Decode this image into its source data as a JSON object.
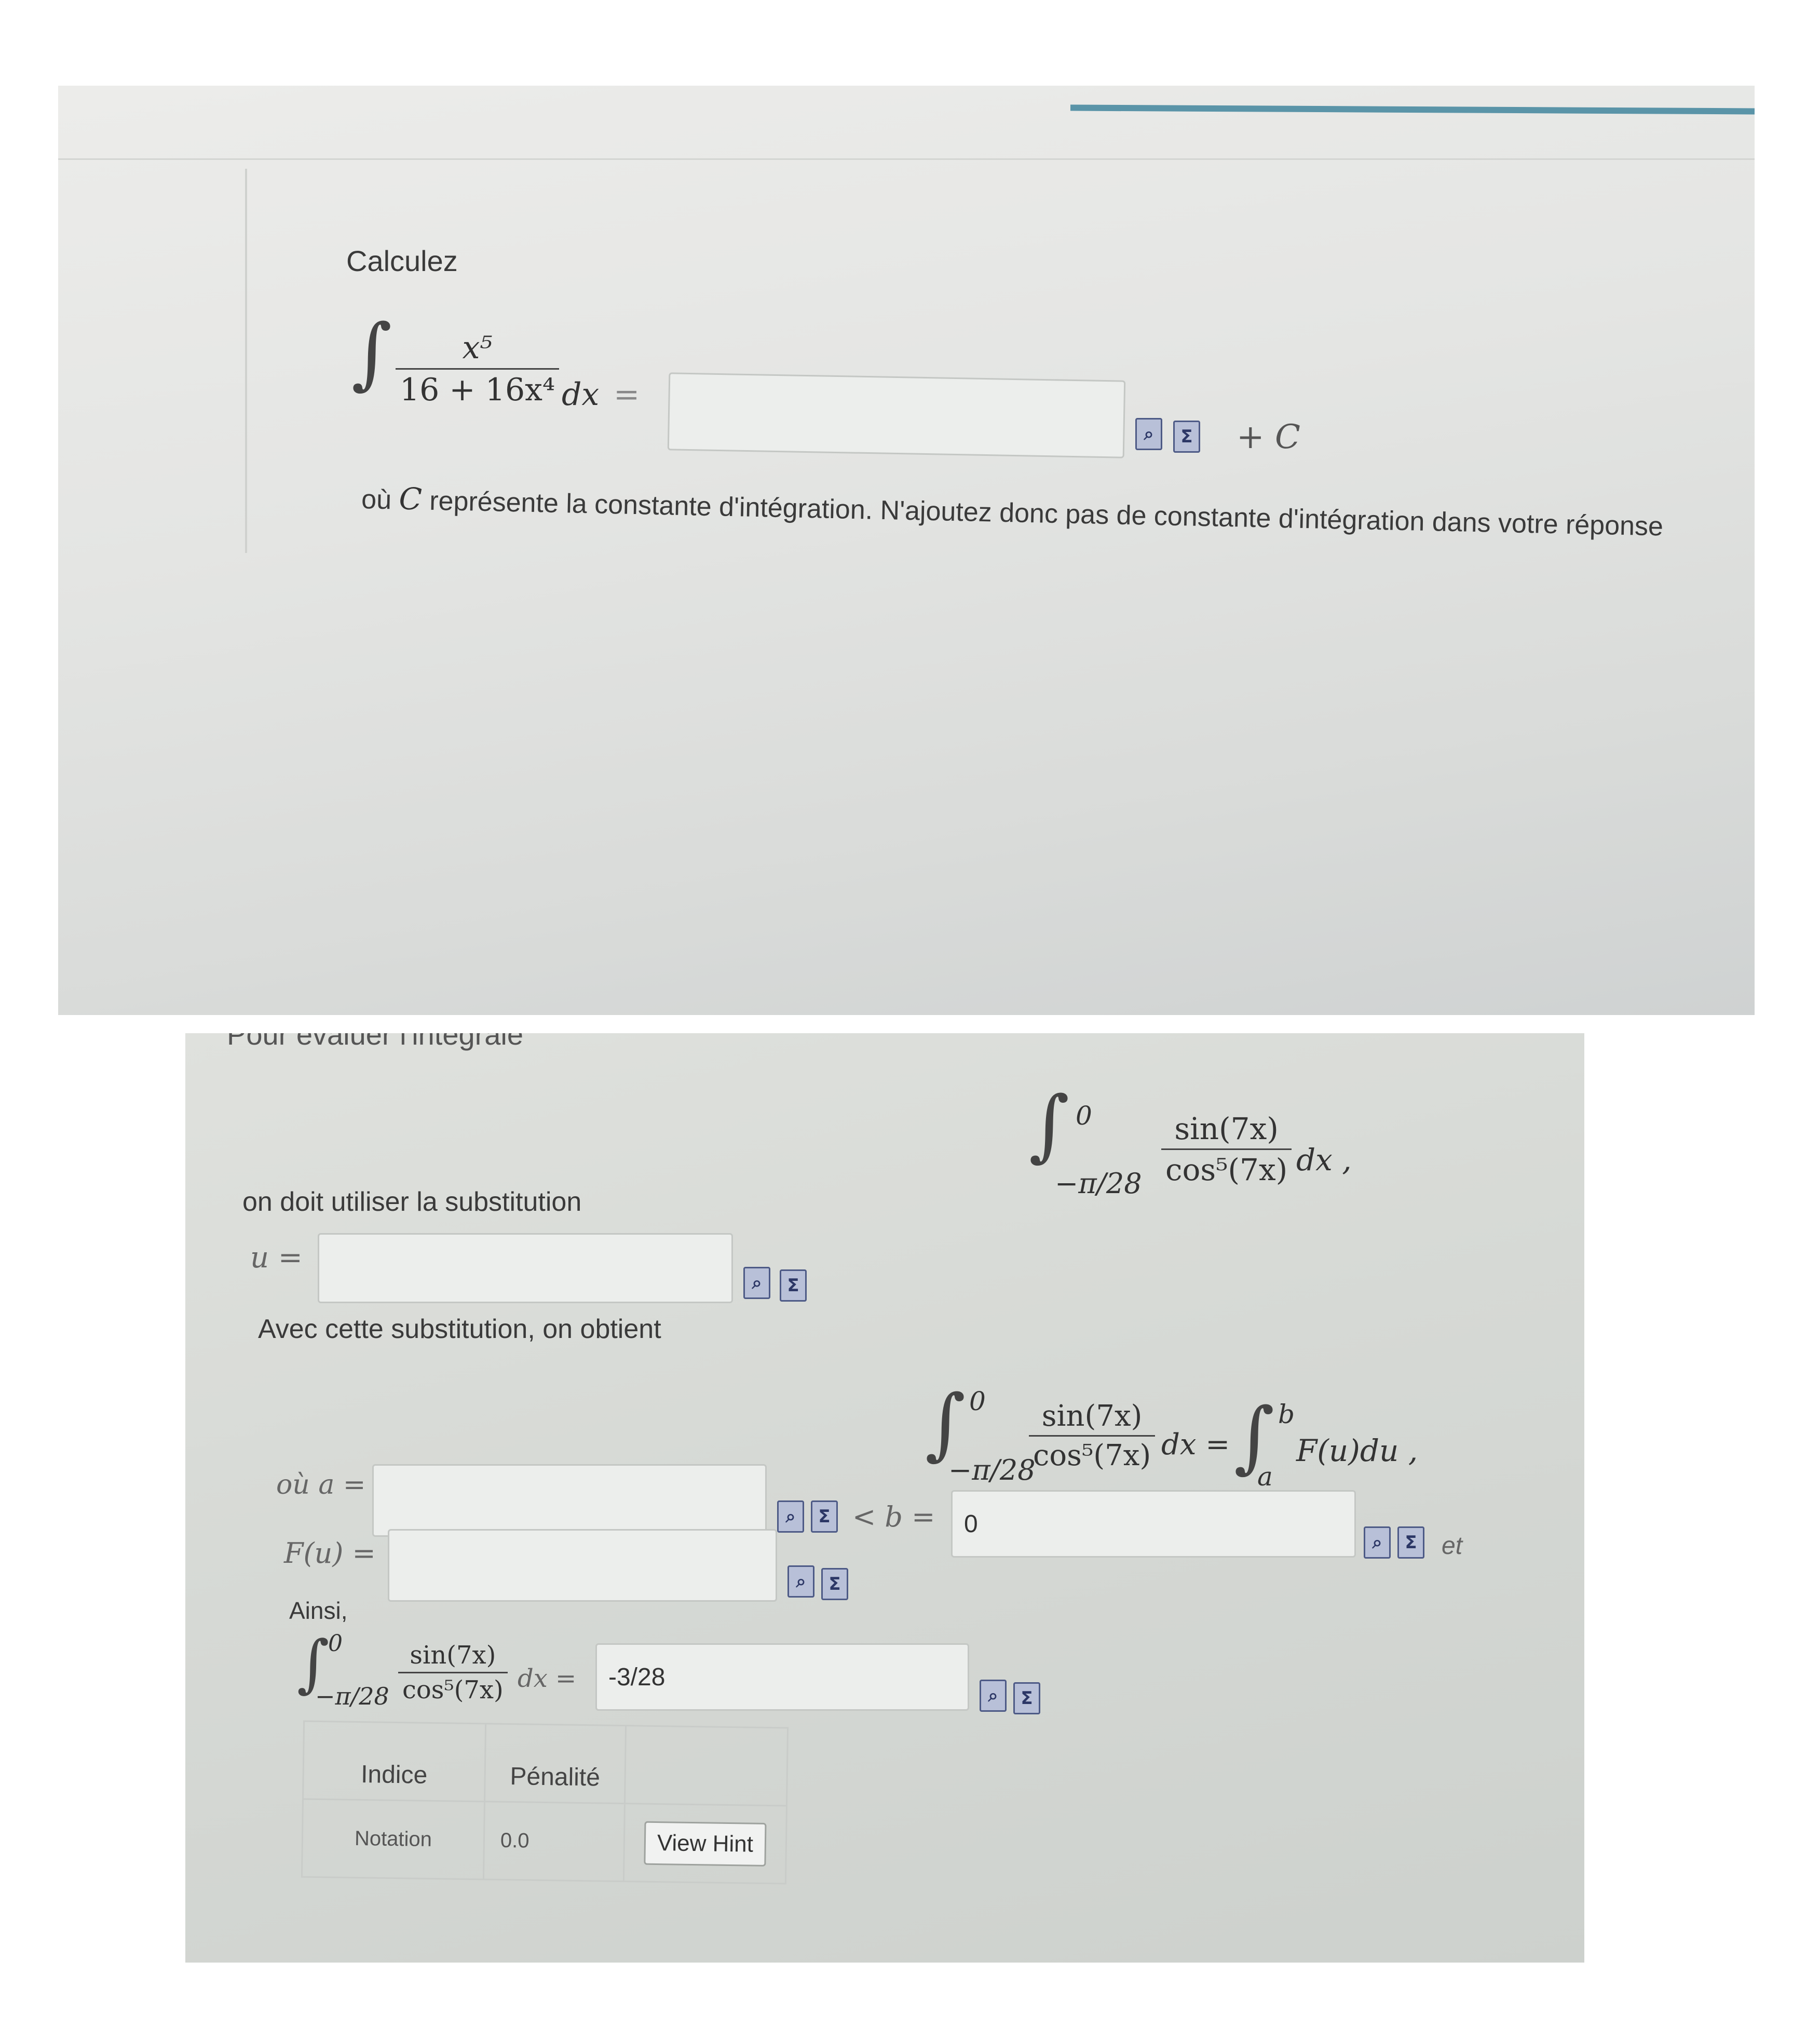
{
  "top": {
    "prompt": "Calculez",
    "integrand_numerator": "x⁵",
    "integrand_denominator": "16 + 16x⁴",
    "dx": "dx",
    "equals": "=",
    "answer_value": "",
    "plus_c": "+ C",
    "note_prefix": "où",
    "note_c": "C",
    "note_text": "représente la constante d'intégration. N'ajoutez donc pas de constante d'intégration dans votre réponse"
  },
  "bottom": {
    "heading": "Pour évaluer l'intégrale",
    "integral_upper": "0",
    "integral_lower": "−π/28",
    "integrand_numerator": "sin(7x)",
    "integrand_denominator": "cos⁵(7x)",
    "dx_comma": "dx ,",
    "substitution_text": "on doit utiliser la substitution",
    "u_label": "u =",
    "u_value": "",
    "obtain_text": "Avec cette substitution, on obtient",
    "rhs_upper": "b",
    "rhs_lower": "a",
    "rhs_integrand": "F(u)du ,",
    "a_label": "où a =",
    "a_value": "",
    "b_label": "< b =",
    "b_value": "0",
    "et": "et",
    "f_label": "F(u) =",
    "f_value": "",
    "ainsi": "Ainsi,",
    "dx_equals": "dx =",
    "result_value": "-3/28",
    "hint_table": {
      "headers": [
        "Indice",
        "Pénalité",
        ""
      ],
      "row": [
        "Notation",
        "0.0"
      ],
      "button": "View Hint"
    }
  },
  "icons": {
    "preview": "preview-icon",
    "equation": "equation-editor-icon"
  }
}
